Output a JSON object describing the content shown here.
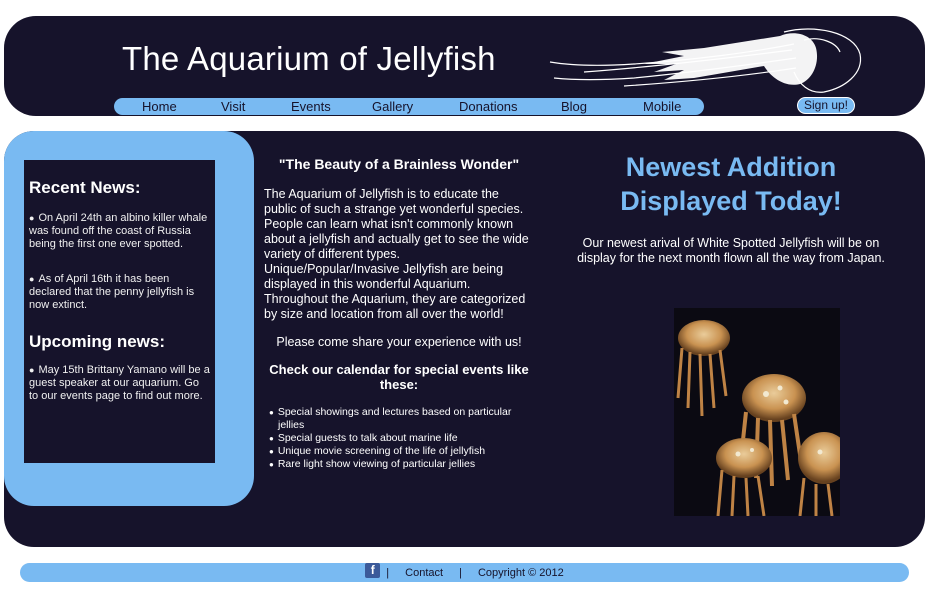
{
  "header": {
    "site_title": "The Aquarium of Jellyfish",
    "nav": [
      "Home",
      "Visit",
      "Events",
      "Gallery",
      "Donations",
      "Blog",
      "Mobile"
    ],
    "signup_label": "Sign up!"
  },
  "sidebar": {
    "recent_heading": "Recent News:",
    "recent_items": [
      "On April 24th an albino killer whale was found off the coast of Russia being the first one ever spotted.",
      "As of April 16th it has been declared that the penny jellyfish is now extinct."
    ],
    "upcoming_heading": "Upcoming news:",
    "upcoming_items": [
      "May 15th Brittany Yamano will be a guest speaker at our aquarium. Go to our events page to find out more."
    ]
  },
  "center": {
    "title": "\"The Beauty of a Brainless Wonder\"",
    "paragraph": "The Aquarium of Jellyfish is to educate the public of such a strange yet wonderful species. People can learn what isn't commonly known about a jellyfish and actually get to see the wide variety of different types. Unique/Popular/Invasive Jellyfish are being displayed in this wonderful Aquarium. Throughout the Aquarium, they are categorized by size and location from all over the world!",
    "share": "Please come share your experience with us!",
    "calendar_heading": "Check our calendar for special events like these:",
    "events": [
      "Special showings and lectures based on particular jellies",
      "Special guests to talk about marine life",
      "Unique movie screening of the life of jellyfish",
      "Rare light show viewing of particular jellies"
    ]
  },
  "feature": {
    "title": "Newest Addition Displayed Today!",
    "text": "Our newest arival of White Spotted Jellyfish will be on display for the next month flown all the way from Japan."
  },
  "footer": {
    "facebook_icon": "f",
    "contact": "Contact",
    "copyright": "Copyright © 2012",
    "separator": "|"
  },
  "colors": {
    "navy": "#16132b",
    "light_blue": "#79baf2"
  }
}
